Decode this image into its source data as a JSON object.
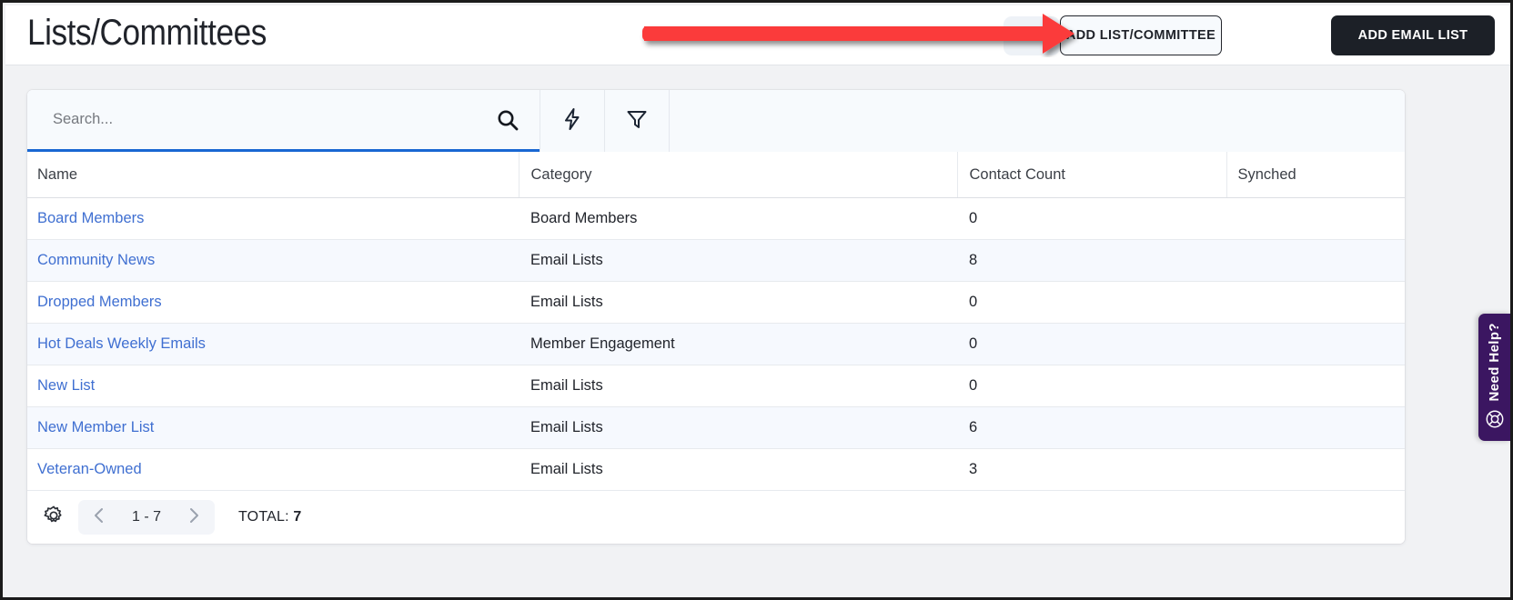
{
  "header": {
    "title": "Lists/Committees",
    "add_list_button": "ADD LIST/COMMITTEE",
    "add_email_list_button": "ADD EMAIL LIST"
  },
  "toolbar": {
    "search_placeholder": "Search...",
    "search_value": "",
    "search_icon": "search-icon",
    "quick_action_icon": "lightning-bolt-icon",
    "filter_icon": "funnel-filter-icon"
  },
  "table": {
    "columns": [
      "Name",
      "Category",
      "Contact Count",
      "Synched"
    ],
    "rows": [
      {
        "name": "Board Members",
        "category": "Board Members",
        "contact_count": "0",
        "synched": ""
      },
      {
        "name": "Community News",
        "category": "Email Lists",
        "contact_count": "8",
        "synched": ""
      },
      {
        "name": "Dropped Members",
        "category": "Email Lists",
        "contact_count": "0",
        "synched": ""
      },
      {
        "name": "Hot Deals Weekly Emails",
        "category": "Member Engagement",
        "contact_count": "0",
        "synched": ""
      },
      {
        "name": "New List",
        "category": "Email Lists",
        "contact_count": "0",
        "synched": ""
      },
      {
        "name": "New Member List",
        "category": "Email Lists",
        "contact_count": "6",
        "synched": ""
      },
      {
        "name": "Veteran-Owned",
        "category": "Email Lists",
        "contact_count": "3",
        "synched": ""
      }
    ]
  },
  "footer": {
    "settings_icon": "gear-icon",
    "prev_icon": "chevron-left-icon",
    "next_icon": "chevron-right-icon",
    "page_range": "1 - 7",
    "total_label": "TOTAL:",
    "total_value": "7"
  },
  "need_help": {
    "label": "Need Help?",
    "icon": "lifebuoy-icon",
    "color": "#3b1661"
  },
  "annotation": {
    "arrow_color": "#fb3b3b",
    "points_to": "ADD LIST/COMMITTEE"
  },
  "colors": {
    "link": "#3f6fd1",
    "dark_button": "#1c2027",
    "focus_underline": "#1967d2",
    "row_alt": "#f6f9fe",
    "page_background": "#f1f2f4"
  }
}
